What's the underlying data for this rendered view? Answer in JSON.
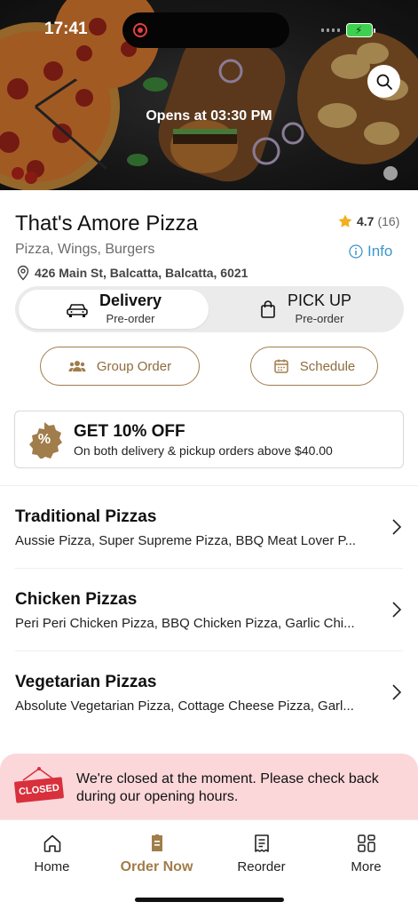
{
  "status_bar": {
    "time": "17:41"
  },
  "hero": {
    "opens_text": "Opens at 03:30 PM"
  },
  "restaurant": {
    "name": "That's Amore Pizza",
    "rating": "4.7",
    "rating_count": "(16)",
    "cuisine": "Pizza, Wings, Burgers",
    "info_label": "Info",
    "address": "426 Main St, Balcatta, Balcatta, 6021"
  },
  "order_type": {
    "delivery": {
      "label": "Delivery",
      "sub": "Pre-order",
      "selected": true
    },
    "pickup": {
      "label": "PICK UP",
      "sub": "Pre-order",
      "selected": false
    }
  },
  "actions": {
    "group_order": "Group Order",
    "schedule": "Schedule"
  },
  "promo": {
    "badge_symbol": "%",
    "title": "GET 10% OFF",
    "subtitle": "On both delivery & pickup orders above $40.00"
  },
  "categories": [
    {
      "title": "Traditional Pizzas",
      "items": "Aussie Pizza, Super Supreme Pizza, BBQ Meat Lover P..."
    },
    {
      "title": "Chicken Pizzas",
      "items": "Peri Peri Chicken Pizza, BBQ Chicken Pizza, Garlic Chi..."
    },
    {
      "title": "Vegetarian Pizzas",
      "items": "Absolute Vegetarian Pizza, Cottage Cheese Pizza, Garl..."
    }
  ],
  "closed_banner": {
    "sign": "CLOSED",
    "message": "We're closed at the moment. Please check back during our opening hours."
  },
  "tabbar": {
    "home": "Home",
    "order_now": "Order Now",
    "reorder": "Reorder",
    "more": "More",
    "active": "order_now"
  },
  "colors": {
    "accent": "#a07d4b",
    "link": "#3e96c9",
    "star": "#f2b01e",
    "closed_banner_bg": "#fbd7da",
    "closed_sign": "#d8303c"
  }
}
